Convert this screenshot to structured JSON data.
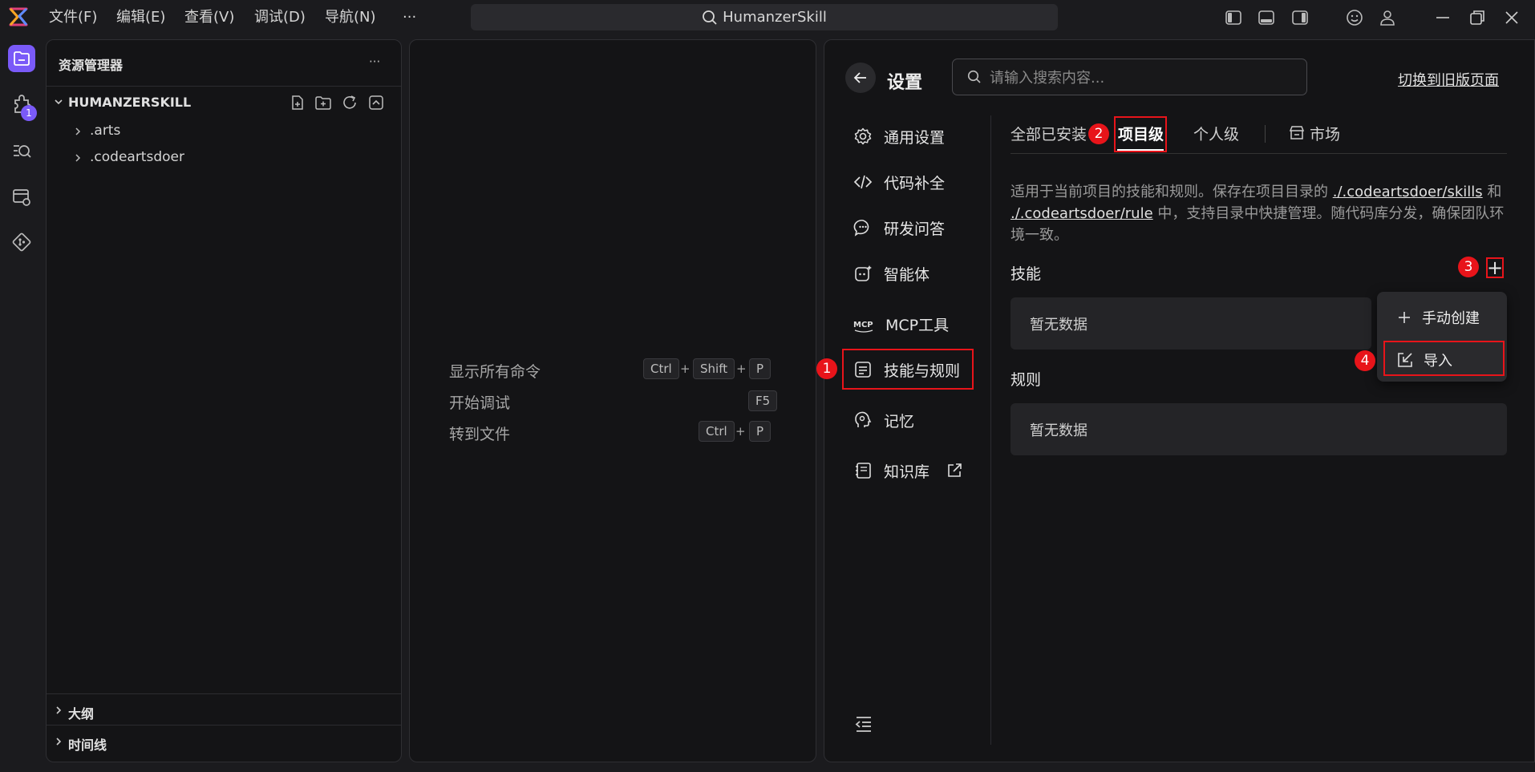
{
  "titlebar": {
    "menus": [
      "文件(F)",
      "编辑(E)",
      "查看(V)",
      "调试(D)",
      "导航(N)",
      "···"
    ],
    "search_text": "HumanzerSkill"
  },
  "activity": {
    "extensions_badge": "1"
  },
  "explorer": {
    "title": "资源管理器",
    "more": "···",
    "root": "HUMANZERSKILL",
    "items": [
      ".arts",
      ".codeartsdoer"
    ],
    "outline": "大纲",
    "timeline": "时间线"
  },
  "editor": {
    "shortcuts": [
      {
        "label": "显示所有命令",
        "keys": [
          "Ctrl",
          "Shift",
          "P"
        ]
      },
      {
        "label": "开始调试",
        "keys": [
          "F5"
        ]
      },
      {
        "label": "转到文件",
        "keys": [
          "Ctrl",
          "P"
        ]
      }
    ],
    "plus": "+"
  },
  "settings": {
    "title": "设置",
    "search_placeholder": "请输入搜索内容...",
    "switch_link": "切换到旧版页面",
    "nav": [
      "通用设置",
      "代码补全",
      "研发问答",
      "智能体",
      "MCP工具",
      "技能与规则",
      "记忆",
      "知识库"
    ],
    "tabs": [
      "全部已安装",
      "项目级",
      "个人级",
      "市场"
    ],
    "desc_prefix": "适用于当前项目的技能和规则。保存在项目目录的",
    "desc_link1": "./.codeartsdoer/skills",
    "desc_and": "和",
    "desc_link2": "./.codeartsdoer/rule",
    "desc_suffix": "中，支持目录中快捷管理。随代码库分发，确保团队环境一致。",
    "skills_label": "技能",
    "skills_empty": "暂无数据",
    "rules_label": "规则",
    "rules_empty": "暂无数据",
    "add_glyph": "+",
    "dropdown": {
      "manual_create": "手动创建",
      "import": "导入"
    }
  },
  "annotations": [
    "1",
    "2",
    "3",
    "4"
  ],
  "colors": {
    "accent": "#7a5af8",
    "highlight": "#e8141a",
    "panel_bg": "#141416"
  }
}
